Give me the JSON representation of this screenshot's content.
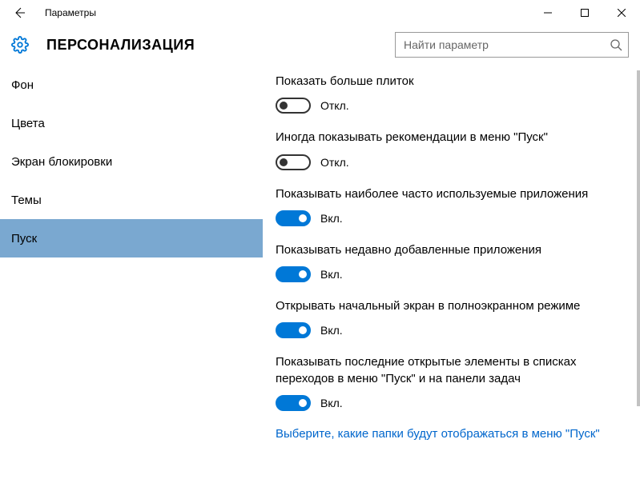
{
  "titlebar": {
    "title": "Параметры"
  },
  "header": {
    "title": "ПЕРСОНАЛИЗАЦИЯ",
    "search_placeholder": "Найти параметр"
  },
  "sidebar": {
    "items": [
      {
        "label": "Фон",
        "selected": false
      },
      {
        "label": "Цвета",
        "selected": false
      },
      {
        "label": "Экран блокировки",
        "selected": false
      },
      {
        "label": "Темы",
        "selected": false
      },
      {
        "label": "Пуск",
        "selected": true
      }
    ]
  },
  "content": {
    "settings": [
      {
        "label": "Показать больше плиток",
        "state": "off",
        "state_label": "Откл."
      },
      {
        "label": "Иногда показывать рекомендации в меню \"Пуск\"",
        "state": "off",
        "state_label": "Откл."
      },
      {
        "label": "Показывать наиболее часто используемые приложения",
        "state": "on",
        "state_label": "Вкл."
      },
      {
        "label": "Показывать недавно добавленные приложения",
        "state": "on",
        "state_label": "Вкл."
      },
      {
        "label": "Открывать начальный экран в полноэкранном режиме",
        "state": "on",
        "state_label": "Вкл."
      },
      {
        "label": "Показывать последние открытые элементы в списках переходов в меню \"Пуск\" и на панели задач",
        "state": "on",
        "state_label": "Вкл."
      }
    ],
    "link": "Выберите, какие папки будут отображаться в меню \"Пуск\""
  }
}
